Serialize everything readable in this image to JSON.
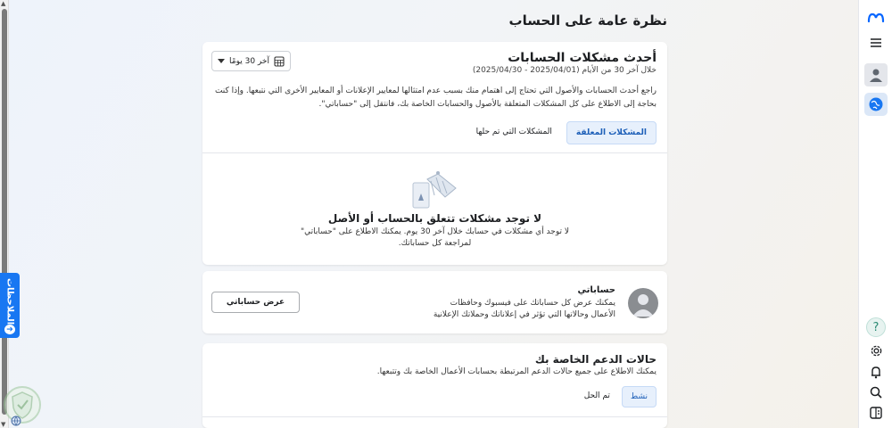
{
  "page": {
    "title": "نظرة عامة على الحساب"
  },
  "feedback": {
    "label": "الملاحظات"
  },
  "rail": {
    "icons": [
      "meta-logo-icon",
      "menu-icon",
      "avatar-icon",
      "globe-icon",
      "help-icon",
      "settings-icon",
      "bell-icon",
      "search-icon",
      "panel-icon"
    ],
    "help_glyph": "?"
  },
  "issues_card": {
    "title": "أحدث مشكلات الحسابات",
    "subtitle": "خلال آخر 30 من الأيام (2025/04/01 - 2025/04/30)",
    "description": "راجع أحدث الحسابات والأصول التي تحتاج إلى اهتمام منك بسبب عدم امتثالها لمعايير الإعلانات أو المعايير الأخرى التي نتبعها. وإذا كنت بحاجة إلى الاطلاع على كل المشكلات المتعلقة بالأصول والحسابات الخاصة بك، فانتقل إلى \"حساباتي\".",
    "date_range": "آخر 30 يومًا",
    "tabs": [
      "المشكلات المعلقة",
      "المشكلات التي تم حلها"
    ],
    "empty_title": "لا توجد مشكلات تتعلق بالحساب أو الأصل",
    "empty_desc": "لا توجد أي مشكلات في حسابك خلال آخر 30 يوم. يمكنك الاطلاع على \"حساباتي\" لمراجعة كل حساباتك."
  },
  "accounts_card": {
    "title": "حساباتي",
    "description": "يمكنك عرض كل حساباتك على فيسبوك وحافظات الأعمال وحالاتها التي تؤثر في إعلاناتك وحملاتك الإعلانية",
    "button": "عرض حساباتي"
  },
  "support_card": {
    "title": "حالات الدعم الخاصة بك",
    "description": "يمكنك الاطلاع على جميع حالات الدعم المرتبطة بحسابات الأعمال الخاصة بك وتتبعها.",
    "tabs": [
      "نشط",
      "تم الحل"
    ]
  },
  "colors": {
    "accent": "#1877f2",
    "active_tab_bg": "#e7f0fc",
    "active_tab_text": "#1d5fb8"
  }
}
